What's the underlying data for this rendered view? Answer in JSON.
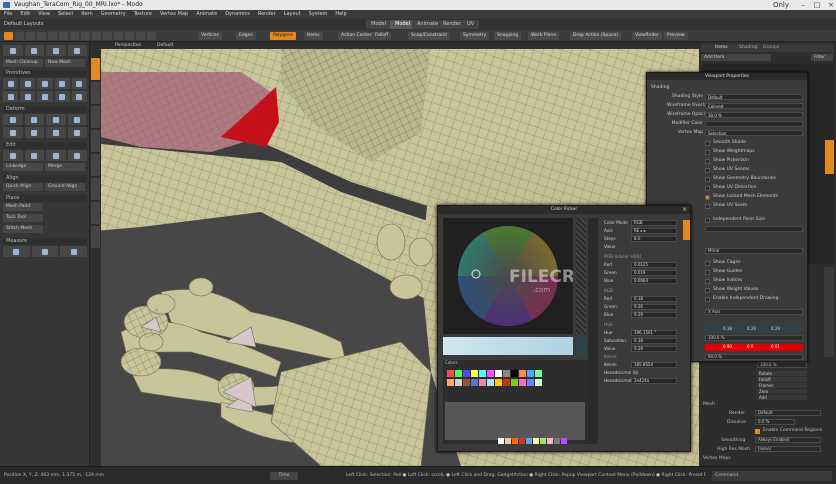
{
  "window": {
    "title": "Vaughan_TeraCom_Rig_00_MRI.lxo* - Modo",
    "user": "Only"
  },
  "menu": [
    "File",
    "Edit",
    "View",
    "Select",
    "Item",
    "Geometry",
    "Texture",
    "Vertex Map",
    "Animate",
    "Dynamics",
    "Render",
    "Layout",
    "System",
    "Help"
  ],
  "layout_bar": {
    "layout_name": "Default Layouts",
    "tabs": [
      "Model",
      "Model",
      "Animate",
      "Render",
      "UV"
    ],
    "active_tab": 1
  },
  "toolbar": {
    "items": [
      "Vertices",
      "Edges",
      "Polygons",
      "Items",
      "Action Center",
      "Falloff",
      "Snap/Constraint",
      "Symmetry",
      "Snapping",
      "Work Plane",
      "Drop Action (Space)",
      "Viewfinder",
      "Preview"
    ],
    "active_item": "Polygons"
  },
  "left_panel": {
    "sections": {
      "tabs_label": "Mesh Cleanup",
      "new_mesh": "New Mesh",
      "primitives": "Primitives",
      "deform": "Deform",
      "edit": "Edit",
      "align": "Align",
      "place": "Place",
      "measure": "Measure"
    },
    "edit_buttons": [
      "Linkedge",
      "Merge"
    ],
    "align_buttons": [
      "Quick Align",
      "Ground Align"
    ],
    "place_buttons": [
      "Mesh Paint",
      "Tack Tool",
      "Stitch Mesh"
    ]
  },
  "viewport": {
    "tab_perspective": "Perspective",
    "tab_default": "Default",
    "watermark": "FILECR",
    "watermark_sub": ".com"
  },
  "viewport_properties": {
    "title": "Viewport Properties",
    "section": "Shading",
    "rows": [
      {
        "label": "Shading Style",
        "value": "Default"
      },
      {
        "label": "Wireframe Overlay",
        "value": "Colored"
      },
      {
        "label": "Wireframe Opacity",
        "value": "30.0 %"
      },
      {
        "label": "Modifier Color",
        "value": ""
      },
      {
        "label": "Vertex Map",
        "value": "Selection"
      }
    ],
    "checkboxes": [
      {
        "label": "Smooth Shade",
        "on": false
      },
      {
        "label": "Show Weightmaps",
        "on": false
      },
      {
        "label": "Show Pickerskin",
        "on": false
      },
      {
        "label": "Show UV Seams",
        "on": false
      },
      {
        "label": "Show Geometry Boundaries",
        "on": false
      },
      {
        "label": "Show UV Distortion",
        "on": false
      },
      {
        "label": "Show Locked Mesh Elements",
        "on": true
      },
      {
        "label": "Show UV Seam",
        "on": false
      }
    ],
    "lower": [
      {
        "label": "Independent Point Size",
        "on": false
      },
      {
        "label": "Show Cages",
        "on": false
      },
      {
        "label": "Show Guides",
        "on": false
      },
      {
        "label": "Show Indices",
        "on": false
      },
      {
        "label": "Show Weight Values",
        "on": false
      },
      {
        "label": "Enable Independent Drawing",
        "on": false
      }
    ],
    "mirror_label": "Mirror",
    "xaxis_value": "X Axis",
    "rgb_fields": [
      "0.18",
      "0.26",
      "0.29"
    ],
    "percent_a": "100.0 %",
    "red_fields": [
      "0.90",
      "0.0",
      "0.01"
    ],
    "percent_b": "90.0 %"
  },
  "color_picker": {
    "title": "Color Picker",
    "color_mode_label": "Color Mode",
    "color_mode_value": "RGB",
    "axis_label": "Axis",
    "axis_value": "RE ▸ ▸",
    "steps_label": "Steps",
    "steps_value": "8.0",
    "value_label": "Value",
    "rgb_linear_label": "RGB (Linear HDR)",
    "linear": [
      {
        "label": "Red",
        "value": "0.0125"
      },
      {
        "label": "Green",
        "value": "0.019"
      },
      {
        "label": "Blue",
        "value": "0.0664"
      }
    ],
    "rgb_label": "RGB",
    "rgb": [
      {
        "label": "Red",
        "value": "0.18"
      },
      {
        "label": "Green",
        "value": "0.26"
      },
      {
        "label": "Blue",
        "value": "0.29"
      }
    ],
    "hsv_label": "HSV",
    "hsv": [
      {
        "label": "Hue",
        "value": "196.1501 °"
      },
      {
        "label": "Saturation",
        "value": "0.38"
      },
      {
        "label": "Value",
        "value": "0.29"
      }
    ],
    "kelvin_label": "Kelvin",
    "kelvin_value": "185.8554",
    "hex_label": "Hexadecimal (8)",
    "hex_value": "2e424a",
    "swatch_group": "Colors",
    "swatches": [
      "#ff4b4b",
      "#4bff4b",
      "#4b4bff",
      "#ffff4b",
      "#4bffff",
      "#ff4bff",
      "#ffffff",
      "#888888",
      "#000000",
      "#ff8844",
      "#44aaff",
      "#66ff99",
      "#ffaa66",
      "#d0d0d0",
      "#995533",
      "#5577cc",
      "#ee88aa",
      "#aaddff",
      "#ffcc00",
      "#cc3300",
      "#77cc22",
      "#ff66cc",
      "#6688ff",
      "#ccffcc"
    ],
    "palette_colors": [
      "#ffffff",
      "#e3c8b0",
      "#ff6a00",
      "#d1342a",
      "#5aa9e6",
      "#fbf4aa",
      "#a1e36b",
      "#ffb3d1",
      "#7a7a7a",
      "#b84dff"
    ]
  },
  "right_column": {
    "tabs": [
      "Items",
      "Shading",
      "Groups"
    ],
    "add_item": "Add Item",
    "filter_label": "Filter",
    "mesh_label": "Mesh",
    "render_label": "Render",
    "render_value": "Default",
    "dissolve_label": "Dissolve",
    "dissolve_value": "0.0 %",
    "enable_cmd": "Enable Command Regions",
    "smoothing_label": "Smoothing",
    "smoothing_value": "Always Enabled",
    "high_res_label": "High Res Mesh",
    "high_res_value": "(none)",
    "vertex_maps_label": "Vertex Maps",
    "percent": "100.0 %",
    "sel_items": [
      "Rotate",
      "Falloff",
      "Frames",
      "Zero",
      "Add"
    ]
  },
  "status": {
    "position": "Position X, Y, Z:   463 mm, 1.375 m, -129 mm",
    "time": "Time",
    "hint": "Left Click: Selection: Poll  ● Left Click: scroll, ● Left Click and Drag: GadgetAction  ● Right Click: Popup Viewport Context Menu (Pulldown)  ● Right Click: Preset File (popup menu)  ● (Any Key) ...",
    "command": "Command"
  },
  "colors": {
    "accent": "#e08a1f",
    "panel": "#363636",
    "mesh_fill": "#c9c59a",
    "mesh_dark": "#8f8c6d",
    "red_mark": "#c4101a"
  }
}
